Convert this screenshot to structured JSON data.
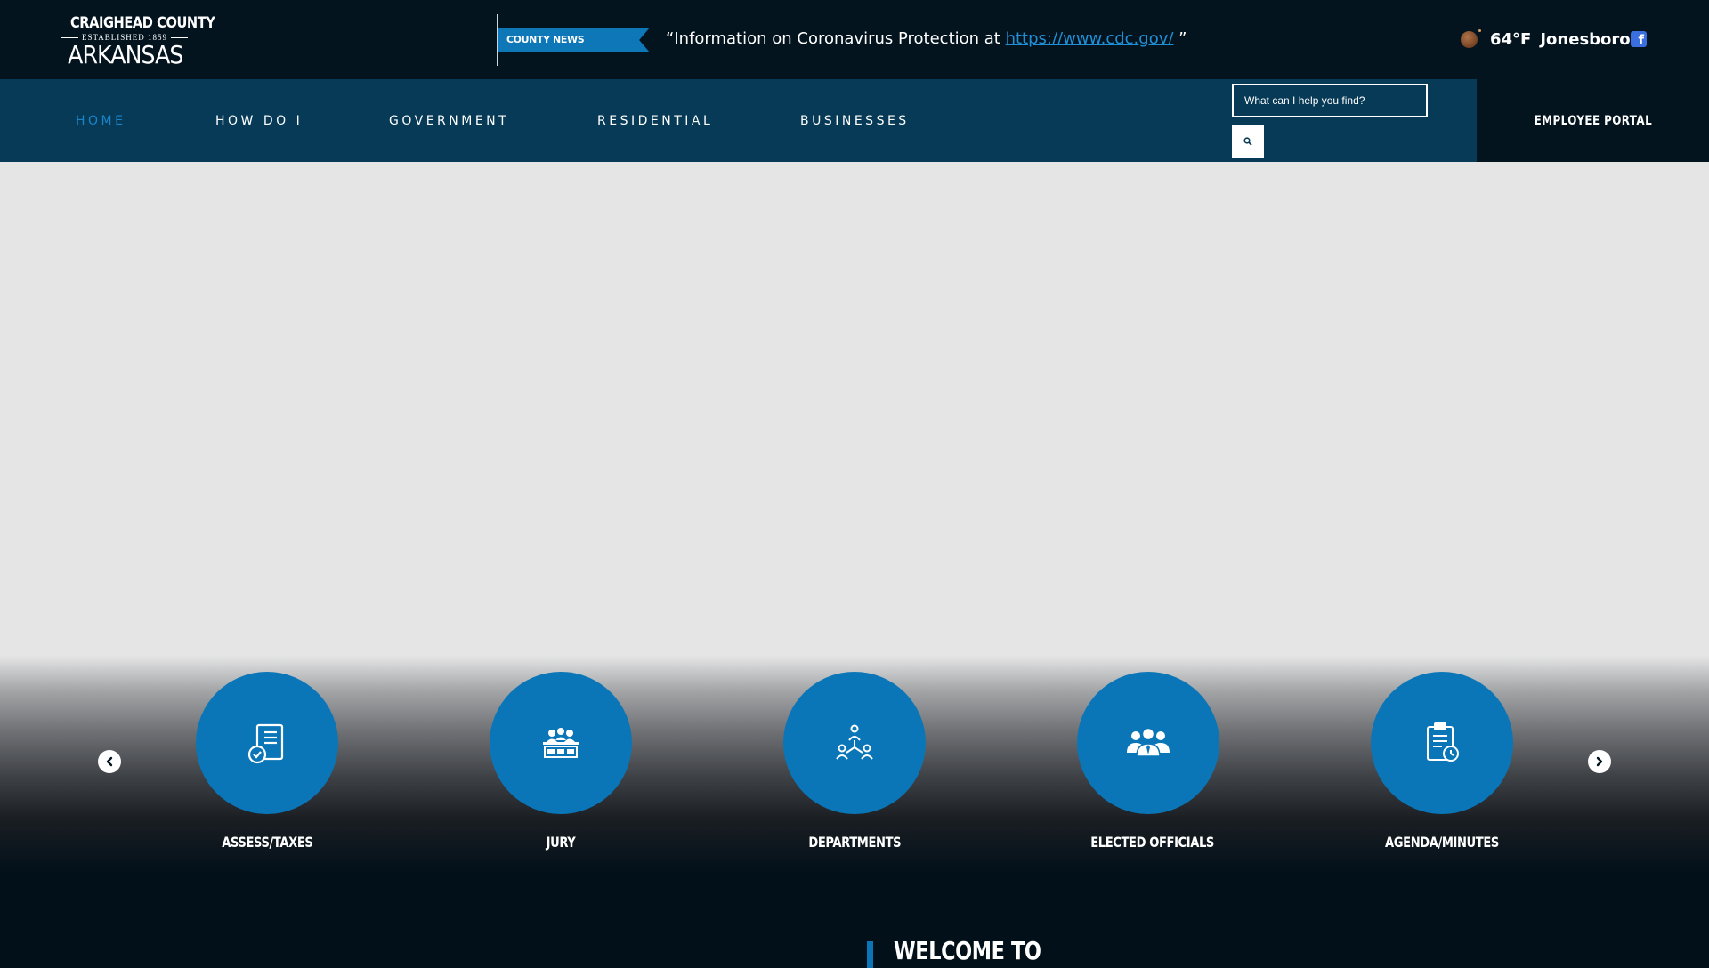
{
  "logo": {
    "line1": "CRAIGHEAD COUNTY",
    "line2": "ESTABLISHED 1859",
    "line3": "ARKANSAS"
  },
  "news": {
    "label": "COUNTY NEWS",
    "text_prefix": "“Information on Coronavirus Protection at ",
    "link": "https://www.cdc.gov/",
    "text_suffix": " ”"
  },
  "weather": {
    "temp": "64°F",
    "city": "Jonesboro",
    "icon": "moon-icon"
  },
  "social": {
    "icon": "facebook-icon"
  },
  "nav": {
    "items": [
      {
        "label": "HOME",
        "active": true
      },
      {
        "label": "HOW DO I",
        "active": false
      },
      {
        "label": "GOVERNMENT",
        "active": false
      },
      {
        "label": "RESIDENTIAL",
        "active": false
      },
      {
        "label": "BUSINESSES",
        "active": false
      }
    ]
  },
  "search": {
    "placeholder": "What can I help you find?",
    "icon": "search-icon"
  },
  "employee_portal": {
    "label": "EMPLOYEE PORTAL"
  },
  "quicklinks": [
    {
      "label": "ASSESS/TAXES",
      "icon": "document-check-icon"
    },
    {
      "label": "JURY",
      "icon": "jury-box-icon"
    },
    {
      "label": "DEPARTMENTS",
      "icon": "org-chart-icon"
    },
    {
      "label": "ELECTED OFFICIALS",
      "icon": "group-icon"
    },
    {
      "label": "AGENDA/MINUTES",
      "icon": "clipboard-clock-icon"
    }
  ],
  "welcome": {
    "heading": "WELCOME TO"
  },
  "colors": {
    "accent": "#0a76b8",
    "nav_bg": "#063a56",
    "top_bg": "#03141f"
  }
}
